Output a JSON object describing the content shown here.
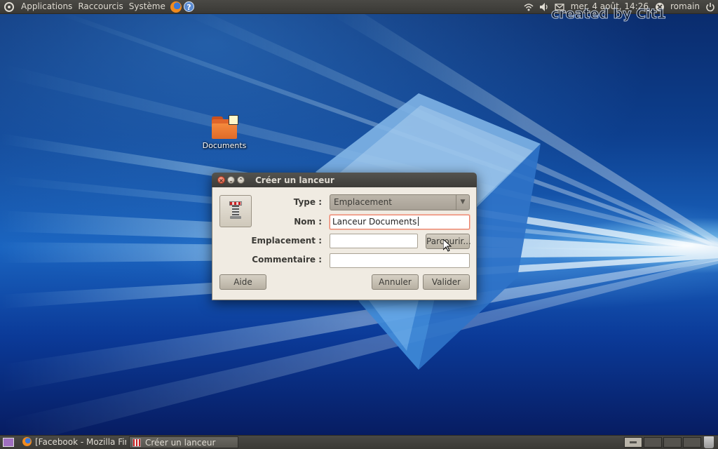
{
  "top_panel": {
    "menus": [
      "Applications",
      "Raccourcis",
      "Système"
    ],
    "clock": "mer.  4 août, 14:26",
    "user": "romain"
  },
  "watermark": "created by Cit1",
  "desktop": {
    "icons": [
      {
        "label": "Documents",
        "icon": "folder-icon"
      }
    ]
  },
  "dialog": {
    "title": "Créer un lanceur",
    "type_label": "Type :",
    "type_value": "Emplacement",
    "name_label": "Nom :",
    "name_value": "Lanceur Documents",
    "location_label": "Emplacement :",
    "location_value": "",
    "browse_label": "Parcourir...",
    "comment_label": "Commentaire :",
    "comment_value": "",
    "help_label": "Aide",
    "cancel_label": "Annuler",
    "ok_label": "Valider"
  },
  "taskbar": {
    "tasks": [
      {
        "label": "[Facebook - Mozilla Fir...",
        "icon": "firefox-icon",
        "active": false
      },
      {
        "label": "Créer un lanceur",
        "icon": "launcher-icon",
        "active": true
      }
    ]
  }
}
